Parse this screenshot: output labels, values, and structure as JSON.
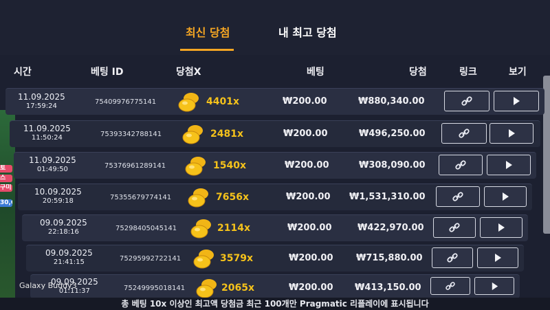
{
  "tabs": [
    {
      "label": "최신 당첨",
      "active": true
    },
    {
      "label": "내 최고 당첨",
      "active": false
    }
  ],
  "columns": {
    "time": "시간",
    "bet_id": "베팅 ID",
    "multiplier": "당첨X",
    "bet": "베팅",
    "win": "당첨",
    "link": "링크",
    "view": "보기"
  },
  "rows": [
    {
      "date": "11.09.2025",
      "time": "17:59:24",
      "bet_id": "75409976775141",
      "multiplier": "4401x",
      "bet": "₩200.00",
      "win": "₩880,340.00"
    },
    {
      "date": "11.09.2025",
      "time": "11:50:24",
      "bet_id": "75393342788141",
      "multiplier": "2481x",
      "bet": "₩200.00",
      "win": "₩496,250.00"
    },
    {
      "date": "11.09.2025",
      "time": "01:49:50",
      "bet_id": "75376961289141",
      "multiplier": "1540x",
      "bet": "₩200.00",
      "win": "₩308,090.00"
    },
    {
      "date": "10.09.2025",
      "time": "20:59:18",
      "bet_id": "75355679774141",
      "multiplier": "7656x",
      "bet": "₩200.00",
      "win": "₩1,531,310.00"
    },
    {
      "date": "09.09.2025",
      "time": "22:18:16",
      "bet_id": "75298405045141",
      "multiplier": "2114x",
      "bet": "₩200.00",
      "win": "₩422,970.00"
    },
    {
      "date": "09.09.2025",
      "time": "21:41:15",
      "bet_id": "75295992722141",
      "multiplier": "3579x",
      "bet": "₩200.00",
      "win": "₩715,880.00"
    },
    {
      "date": "09.09.2025",
      "time": "01:11:37",
      "bet_id": "75249995018141",
      "multiplier": "2065x",
      "bet": "₩200.00",
      "win": "₩413,150.00"
    }
  ],
  "footer": "총 베팅 10x 이상인 최고액 당첨금 최근 100개만 Pragmatic 리플레이에 표시됩니다",
  "watermark": "Galaxy Buddy3",
  "side_decoration": [
    "토",
    "스",
    "구미",
    "30,0"
  ],
  "colors": {
    "accent": "#f5a623",
    "multiplier": "#f5c21b",
    "background": "#1c2030",
    "row": "#2a2f42"
  },
  "icons": {
    "link": "link-chain-icon",
    "view": "play-icon",
    "multiplier": "gold-coins-icon"
  }
}
